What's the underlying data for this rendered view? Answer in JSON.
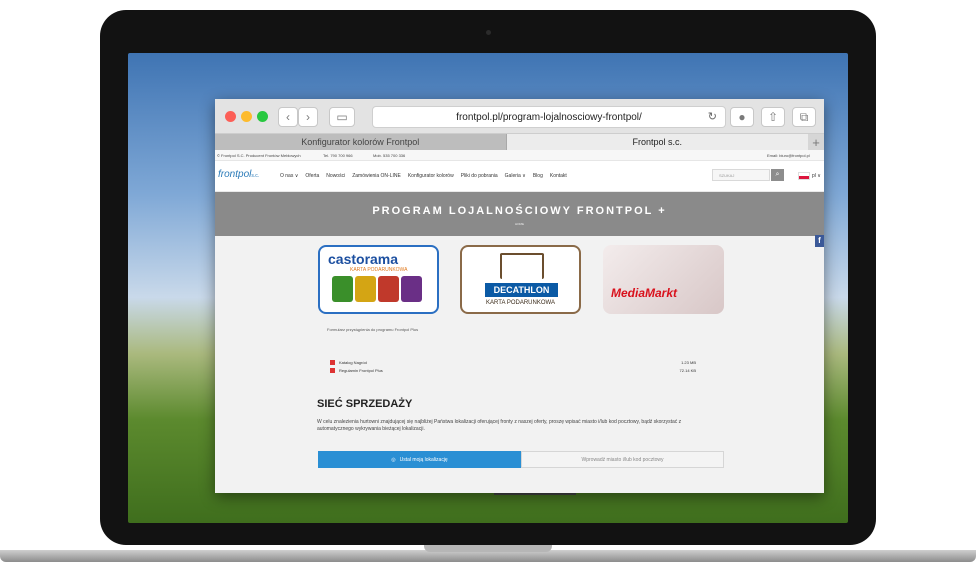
{
  "browser": {
    "url": "frontpol.pl/program-lojalnosciowy-frontpol/",
    "tabs": [
      {
        "label": "Konfigurator kolorów Frontpol"
      },
      {
        "label": "Frontpol s.c."
      }
    ],
    "new_tab": "+"
  },
  "site": {
    "top_strip": {
      "company": "© Frontpol S.C. Producent Frontów Meblowych",
      "tel": "Tel. 790 700 966",
      "mob": "Mob. 535 700 336",
      "email": "Email: biuro@frontpol.pl"
    },
    "logo": {
      "main": "frontpol",
      "suffix": "s.c."
    },
    "menu": [
      {
        "label": "O nas ∨"
      },
      {
        "label": "Oferta"
      },
      {
        "label": "Nowości"
      },
      {
        "label": "Zamówienia ON-LINE"
      },
      {
        "label": "Konfigurator kolorów"
      },
      {
        "label": "Pliki do pobrania"
      },
      {
        "label": "Galeria ∨"
      },
      {
        "label": "Blog"
      },
      {
        "label": "Kontakt"
      }
    ],
    "search_placeholder": "SZUKAJ",
    "language": "pl ∨",
    "hero": {
      "title": "PROGRAM LOJALNOŚCIOWY FRONTPOL +",
      "breadcrumb": "HOME"
    },
    "cards": {
      "castorama": {
        "brand": "castorama",
        "sub": "KARTA PODARUNKOWA"
      },
      "decathlon": {
        "brand": "DECATHLON",
        "sub": "KARTA PODARUNKOWA"
      },
      "mediamarkt": {
        "brand": "MediaMarkt"
      }
    },
    "form_note": "Formularz przystąpienia do programu Frontpol Plus",
    "files": [
      {
        "name": "Katalog Nagród",
        "size": "1.23 MB"
      },
      {
        "name": "Regulamin Frontpol Plus",
        "size": "72.14 KB"
      }
    ],
    "section_title": "SIEĆ SPRZEDAŻY",
    "section_text": "W celu znalezienia hurtowni znajdującej się najbliżej Państwa lokalizacji oferującej fronty z naszej oferty, proszę wpisać miasto i/lub kod pocztowy, bądź skorzystać z automatycznego wykrywania bieżącej lokalizacji.",
    "locate_tabs": [
      {
        "label": "Ustal moją lokalizację"
      },
      {
        "label": "Wprowadź miasto i/lub kod pocztowy"
      }
    ]
  },
  "colors": {
    "accent": "#2a8fd4",
    "hero_bg": "#8a8a8a",
    "brand_blue": "#2a7ab8"
  }
}
